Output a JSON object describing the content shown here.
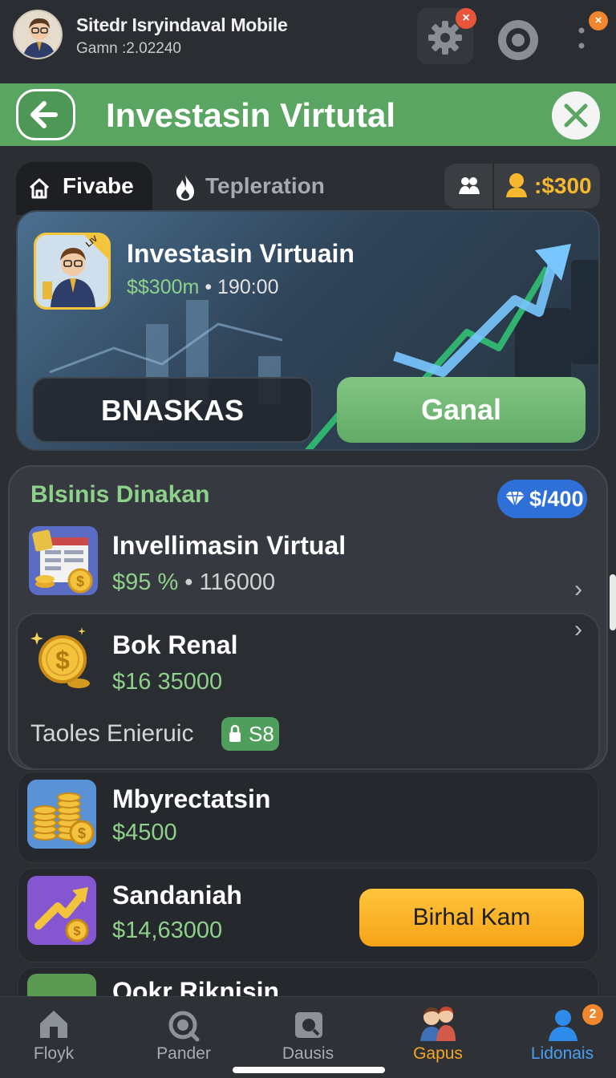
{
  "header": {
    "app_name": "Sitedr Isryindaval Mobile",
    "subtitle": "Gamn :2.02240",
    "settings_badge": "×",
    "menu_badge": "×"
  },
  "titlebar": {
    "title": "Investasin Virtutal"
  },
  "tabs": [
    {
      "label": "Fivabe",
      "active": true
    },
    {
      "label": "Tepleration",
      "active": false
    }
  ],
  "balance": {
    "coins": ":$300"
  },
  "hero": {
    "title": "Investasin Virtuain",
    "value": "$$300m",
    "count": "• 190:00",
    "thumb_badge": "LIV",
    "secondary_button": "BNASKAS",
    "primary_button": "Ganal"
  },
  "business": {
    "title": "Blsinis Dinakan",
    "gem_value": "$/400",
    "items": [
      {
        "title": "Invellimasin Virtual",
        "value": "$95 %",
        "extra": "• 116000"
      },
      {
        "title": "Bok Renal",
        "value": "$16 35000"
      }
    ],
    "footer_label": "Taoles Enieruic",
    "footer_pill": "S8"
  },
  "list": [
    {
      "title": "Mbyrectatsin",
      "value": "$4500"
    },
    {
      "title": "Sandaniah",
      "value": "$14,63000",
      "button": "Birhal Kam"
    },
    {
      "title": "Qokr Riknisin"
    }
  ],
  "nav": [
    {
      "label": "Floyk",
      "icon": "home-icon"
    },
    {
      "label": "Pander",
      "icon": "search-icon"
    },
    {
      "label": "Dausis",
      "icon": "briefcase-icon"
    },
    {
      "label": "Gapus",
      "icon": "people-icon",
      "active": true
    },
    {
      "label": "Lidonais",
      "icon": "profile-icon",
      "badge": "2"
    }
  ],
  "colors": {
    "accent_green": "#5aa562",
    "value_green": "#8ed18a",
    "orange": "#f6a317",
    "blue": "#2f6fd8"
  }
}
